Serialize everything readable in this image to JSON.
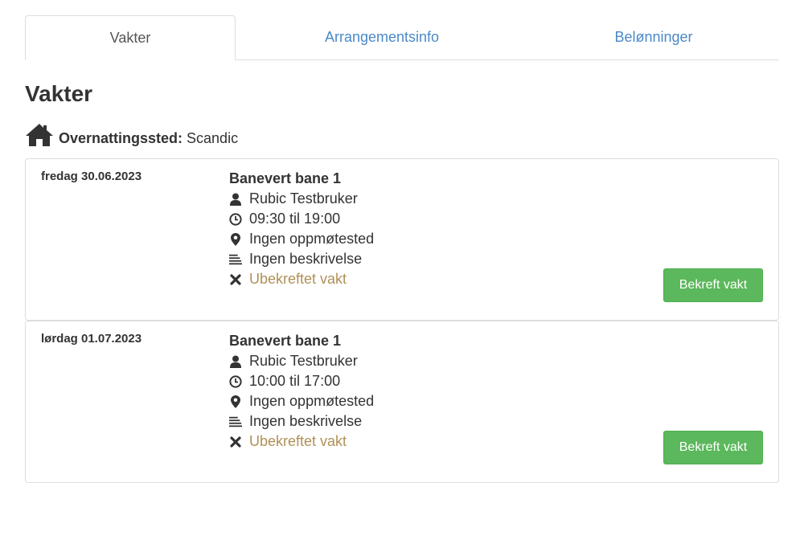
{
  "tabs": [
    {
      "label": "Vakter",
      "active": true
    },
    {
      "label": "Arrangementsinfo",
      "active": false
    },
    {
      "label": "Belønninger",
      "active": false
    }
  ],
  "page_title": "Vakter",
  "lodging": {
    "icon": "home-icon",
    "label": "Overnattingssted:",
    "value": "Scandic"
  },
  "shifts": [
    {
      "date": "fredag 30.06.2023",
      "title": "Banevert bane 1",
      "person": "Rubic Testbruker",
      "time": "09:30 til 19:00",
      "meeting_place": "Ingen oppmøtested",
      "description": "Ingen beskrivelse",
      "status": "Ubekreftet vakt",
      "confirm_label": "Bekreft vakt"
    },
    {
      "date": "lørdag 01.07.2023",
      "title": "Banevert bane 1",
      "person": "Rubic Testbruker",
      "time": "10:00 til 17:00",
      "meeting_place": "Ingen oppmøtested",
      "description": "Ingen beskrivelse",
      "status": "Ubekreftet vakt",
      "confirm_label": "Bekreft vakt"
    }
  ],
  "colors": {
    "link": "#4a89c8",
    "status_unconfirmed": "#b09057",
    "confirm_button": "#5cb85c"
  }
}
